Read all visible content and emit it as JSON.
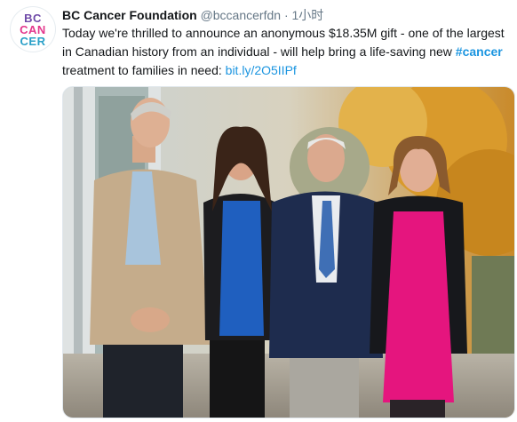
{
  "tweet": {
    "author_name": "BC Cancer Foundation",
    "handle": "@bccancerfdn",
    "separator": "·",
    "time": "1小时",
    "text_before": "Today we're thrilled to announce an anonymous $18.35M gift - one of the largest in Canadian history from an individual - will help bring a life-saving new ",
    "hashtag": "#cancer",
    "text_after": " treatment to families in need: ",
    "link": "bit.ly/2O5IIPf"
  },
  "avatar": {
    "logo_line1": "BC",
    "logo_line2": "CAN",
    "logo_line3": "CER"
  },
  "colors": {
    "link": "#1b95e0",
    "logo_purple": "#6f4aa8",
    "logo_pink": "#e3378c",
    "logo_blue": "#2aa0c8"
  }
}
